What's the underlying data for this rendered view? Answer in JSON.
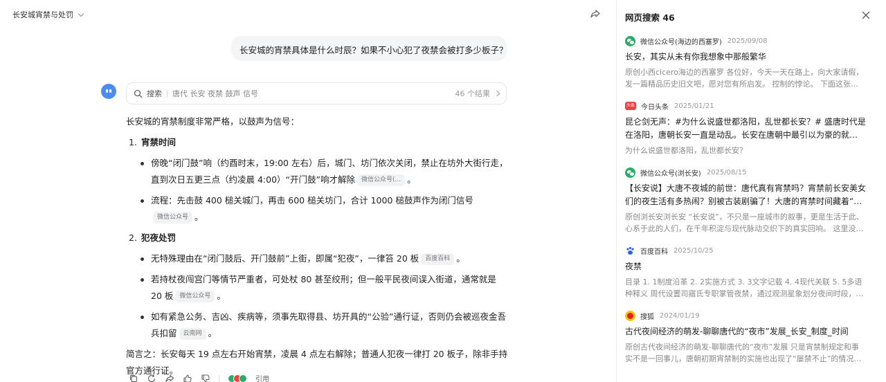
{
  "header": {
    "conversation_title": "长安城宵禁与处罚"
  },
  "user_message": "长安城的宵禁具体是什么时辰？如果不小心犯了夜禁会被打多少板子？",
  "search_card": {
    "label": "搜索",
    "query": "唐代 长安 夜禁 鼓声 信号",
    "count": "46 个结果"
  },
  "answer": {
    "intro": "长安城的宵禁制度非常严格，以鼓声为信号：",
    "sections": [
      {
        "num": "1.",
        "heading": "宵禁时间",
        "bullets": [
          {
            "text": "傍晚“闭门鼓”响（约酉时末，19:00 左右）后，城门、坊门依次关闭，禁止在坊外大街行走，直到次日五更三点（约凌晨 4:00）“开门鼓”响才解除",
            "cite": "微信公众号(...",
            "tail": "。"
          },
          {
            "text": "流程：先击鼓 400 槌关城门，再击 600 槌关坊门，合计 1000 槌鼓声作为闭门信号",
            "cite": "微信公众号",
            "tail": "。"
          }
        ]
      },
      {
        "num": "2.",
        "heading": "犯夜处罚",
        "bullets": [
          {
            "text": "无特殊理由在“闭门鼓后、开门鼓前”上街，即属“犯夜”，一律笞 20 板",
            "cite": "百度百科",
            "tail": "。"
          },
          {
            "text": "若持杖夜闯宫门等情节严重者，可处杖 80 甚至绞刑；但一般平民夜间误入街道，通常就是 20 板",
            "cite": "微信公众号",
            "tail": "。"
          },
          {
            "text": "如有紧急公务、吉凶、疾病等，须事先取得县、坊开具的“公验”通行证，否则仍会被巡夜金吾兵扣留",
            "cite": "云南网",
            "tail": "。"
          }
        ]
      }
    ],
    "summary": "简言之：长安每天 19 点左右开始宵禁，凌晨 4 点左右解除；普通人犯夜一律打 20 板子，除非手持官方通行证。"
  },
  "actions": {
    "cite_label": "引用"
  },
  "panel": {
    "title": "网页搜索 46",
    "results": [
      {
        "source": "微信公众号(海边的西塞罗)",
        "date": "2025/09/08",
        "title": "长安，其实从未有你我想象中那般繁华",
        "snippet": "原创小西cicero海边的西塞罗 各位好，今天一天在路上，向大家请假，发一篇精品历史旧文吧，愿对您有所启发。 控制的悖论。 下面这张图，...",
        "icon": "wechat-icon"
      },
      {
        "source": "今日头条",
        "date": "2025/01/21",
        "title": "昆仑剑无声：#为什么说盛世都洛阳，乱世都长安？# 盛唐时代是在洛阳，唐朝长安一直是动乱。长安在唐朝中最引以为豪的就是贞观...",
        "snippet": "为什么说盛世都洛阳，乱世都长安？",
        "icon": "toutiao-icon",
        "icon_text": "头条"
      },
      {
        "source": "微信公众号(浏长安)",
        "date": "2025/08/15",
        "title": "【长安说】大唐不夜城的前世：唐代真有宵禁吗？宵禁前长安美女们的夜生活有多热闹？别被古装剧骗了！大唐的宵禁时间藏着“松弛感”",
        "snippet": "原创浏长安浏长安 “长安说”，不只是一座城市的叙事，更是生活于此、心系于此的人们，在千年积淀与现代脉动交织下的真实回响。 这里没有宏...",
        "icon": "wechat-icon"
      },
      {
        "source": "百度百科",
        "date": "2025/10/25",
        "title": "夜禁",
        "snippet": "目录 1. 1制度沿革 2. 2实施方式 3. 3文字记载 4. 4现代关联 5. 5多语种释义 周代设置司寤氏专职掌管夜禁，通过观测星象划分夜间时段，派遣“夜...",
        "icon": "baike-paw-icon"
      },
      {
        "source": "搜狐",
        "date": "2024/01/19",
        "title": "古代夜间经济的萌发-聊聊唐代的“夜市”发展_长安_制度_时间",
        "snippet": "原创古代夜间经济的萌发-聊聊唐代的“夜市”发展 只是宵禁制规定和事实不是一回事儿，唐朝初期宵禁制的实施也出现了“屡禁不止”的情况。由...",
        "icon": "sohu-icon"
      }
    ]
  },
  "colors": {
    "accent": "#4a8cf0",
    "wechat": "#2aae67",
    "toutiao": "#f04142",
    "sohu": "#f7c600"
  }
}
